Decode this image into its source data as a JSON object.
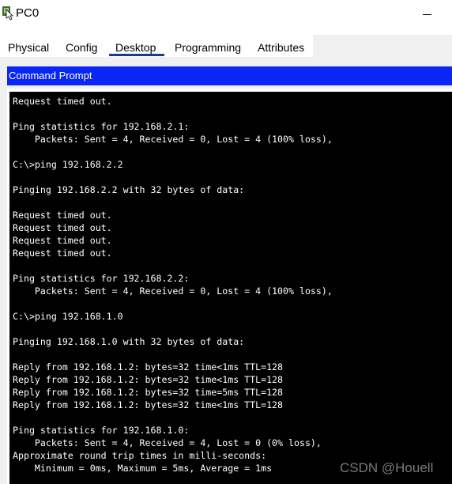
{
  "window": {
    "title": "PC0",
    "icon": "pc-app-icon"
  },
  "tabs": [
    {
      "label": "Physical",
      "active": false
    },
    {
      "label": "Config",
      "active": false
    },
    {
      "label": "Desktop",
      "active": true
    },
    {
      "label": "Programming",
      "active": false
    },
    {
      "label": "Attributes",
      "active": false
    }
  ],
  "command_prompt": {
    "header": "Command Prompt",
    "lines": [
      "Request timed out.",
      "",
      "Ping statistics for 192.168.2.1:",
      "    Packets: Sent = 4, Received = 0, Lost = 4 (100% loss),",
      "",
      "C:\\>ping 192.168.2.2",
      "",
      "Pinging 192.168.2.2 with 32 bytes of data:",
      "",
      "Request timed out.",
      "Request timed out.",
      "Request timed out.",
      "Request timed out.",
      "",
      "Ping statistics for 192.168.2.2:",
      "    Packets: Sent = 4, Received = 0, Lost = 4 (100% loss),",
      "",
      "C:\\>ping 192.168.1.0",
      "",
      "Pinging 192.168.1.0 with 32 bytes of data:",
      "",
      "Reply from 192.168.1.2: bytes=32 time<1ms TTL=128",
      "Reply from 192.168.1.2: bytes=32 time<1ms TTL=128",
      "Reply from 192.168.1.2: bytes=32 time=5ms TTL=128",
      "Reply from 192.168.1.2: bytes=32 time<1ms TTL=128",
      "",
      "Ping statistics for 192.168.1.0:",
      "    Packets: Sent = 4, Received = 4, Lost = 0 (0% loss),",
      "Approximate round trip times in milli-seconds:",
      "    Minimum = 0ms, Maximum = 5ms, Average = 1ms"
    ]
  },
  "watermark": "CSDN @Houell",
  "colors": {
    "header_blue": "#0a26f5",
    "terminal_bg": "#000000",
    "terminal_fg": "#ffffff",
    "tab_underline": "#1a3a8a"
  }
}
